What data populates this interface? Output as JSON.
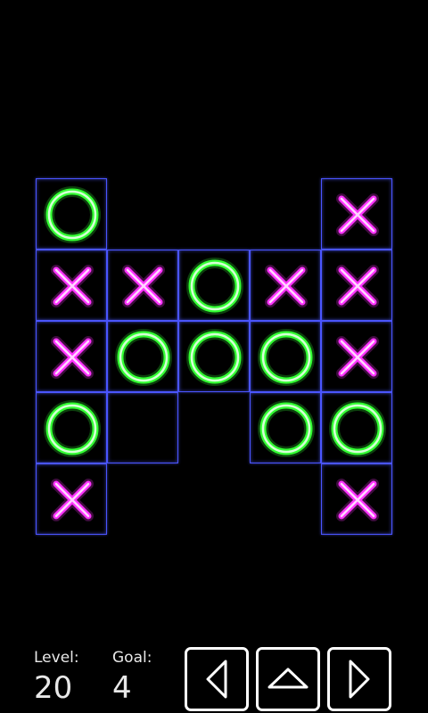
{
  "colors": {
    "grid_line": "#4a55ff",
    "x_mark": "#ff33ff",
    "o_mark": "#33ff33",
    "background": "#000000",
    "text": "#e8e8e8"
  },
  "board": {
    "columns": 5,
    "rows": 5,
    "cells": [
      [
        "O",
        null,
        null,
        null,
        "X"
      ],
      [
        "X",
        "X",
        "O",
        "X",
        "X"
      ],
      [
        "X",
        "O",
        "O",
        "O",
        "X"
      ],
      [
        "O",
        "",
        null,
        "O",
        "O"
      ],
      [
        "X",
        null,
        null,
        null,
        "X"
      ]
    ]
  },
  "hud": {
    "level_label": "Level:",
    "level_value": "20",
    "goal_label": "Goal:",
    "goal_value": "4"
  },
  "controls": {
    "prev_icon": "triangle-left-icon",
    "up_icon": "triangle-up-icon",
    "next_icon": "triangle-right-icon"
  }
}
